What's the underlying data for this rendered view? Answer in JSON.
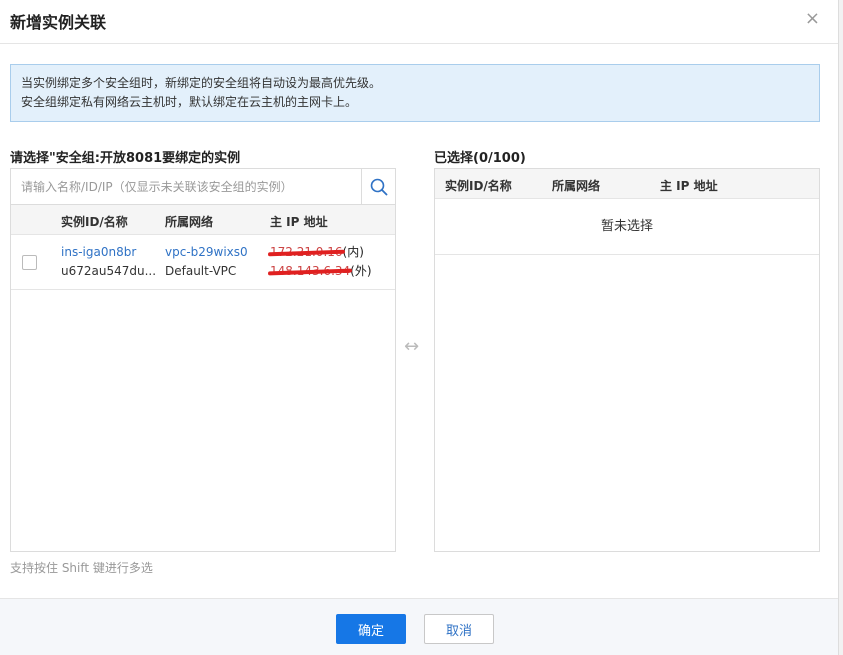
{
  "dialog": {
    "title": "新增实例关联",
    "close_glyph": "×"
  },
  "notice": {
    "line1": "当实例绑定多个安全组时，新绑定的安全组将自动设为最高优先级。",
    "line2": "安全组绑定私有网络云主机时，默认绑定在云主机的主网卡上。"
  },
  "left": {
    "title": "请选择\"安全组:开放8081要绑定的实例",
    "search_placeholder": "请输入名称/ID/IP（仅显示未关联该安全组的实例）",
    "columns": [
      "实例ID/名称",
      "所属网络",
      "主 IP 地址"
    ],
    "rows": [
      {
        "id": "ins-iga0n8br",
        "name": "u672au547du...",
        "vpc_id": "vpc-b29wixs0",
        "vpc_name": "Default-VPC",
        "ip_inner": "172.21.0.16",
        "ip_inner_suffix": "(内)",
        "ip_outer": "148.143.6.34",
        "ip_outer_suffix": "(外)"
      }
    ]
  },
  "right": {
    "title": "已选择(0/100)",
    "columns": [
      "实例ID/名称",
      "所属网络",
      "主 IP 地址"
    ],
    "empty_text": "暂未选择"
  },
  "transfer_glyph": "↔",
  "hint": "支持按住 Shift 键进行多选",
  "footer": {
    "confirm_label": "确定",
    "cancel_label": "取消"
  },
  "colors": {
    "primary": "#1677e6",
    "link": "#2f72c5",
    "notice_bg": "#e3f0fb",
    "redaction": "#e02020"
  }
}
